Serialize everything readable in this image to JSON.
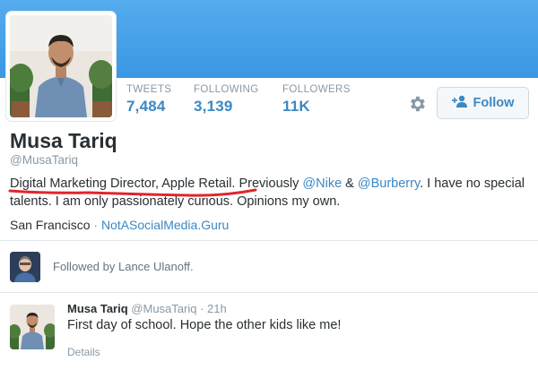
{
  "profile": {
    "name": "Musa Tariq",
    "handle": "@MusaTariq",
    "stats": [
      {
        "label": "TWEETS",
        "value": "7,484"
      },
      {
        "label": "FOLLOWING",
        "value": "3,139"
      },
      {
        "label": "FOLLOWERS",
        "value": "11K"
      }
    ],
    "follow_label": "Follow",
    "bio": {
      "part1": "Digital Marketing Director, Apple Retail",
      "part2": ". Previously ",
      "mention1": "@Nike",
      "part3": " & ",
      "mention2": "@Burberry",
      "part4": ". I have no special talents. I am only passionately curious. Opinions my own."
    },
    "location": "San Francisco",
    "separator": "·",
    "website": "NotASocialMedia.Guru"
  },
  "followed_by": {
    "prefix": "Followed by ",
    "name": "Lance Ulanoff",
    "suffix": "."
  },
  "tweet": {
    "name": "Musa Tariq",
    "handle": "@MusaTariq",
    "time": "· 21h",
    "text": "First day of school. Hope the other kids like me!",
    "details_label": "Details"
  },
  "colors": {
    "banner": "#55acee",
    "link": "#3b88c3",
    "annotation_underline": "#e0262b"
  },
  "icons": [
    "gear-icon",
    "add-person-icon"
  ]
}
